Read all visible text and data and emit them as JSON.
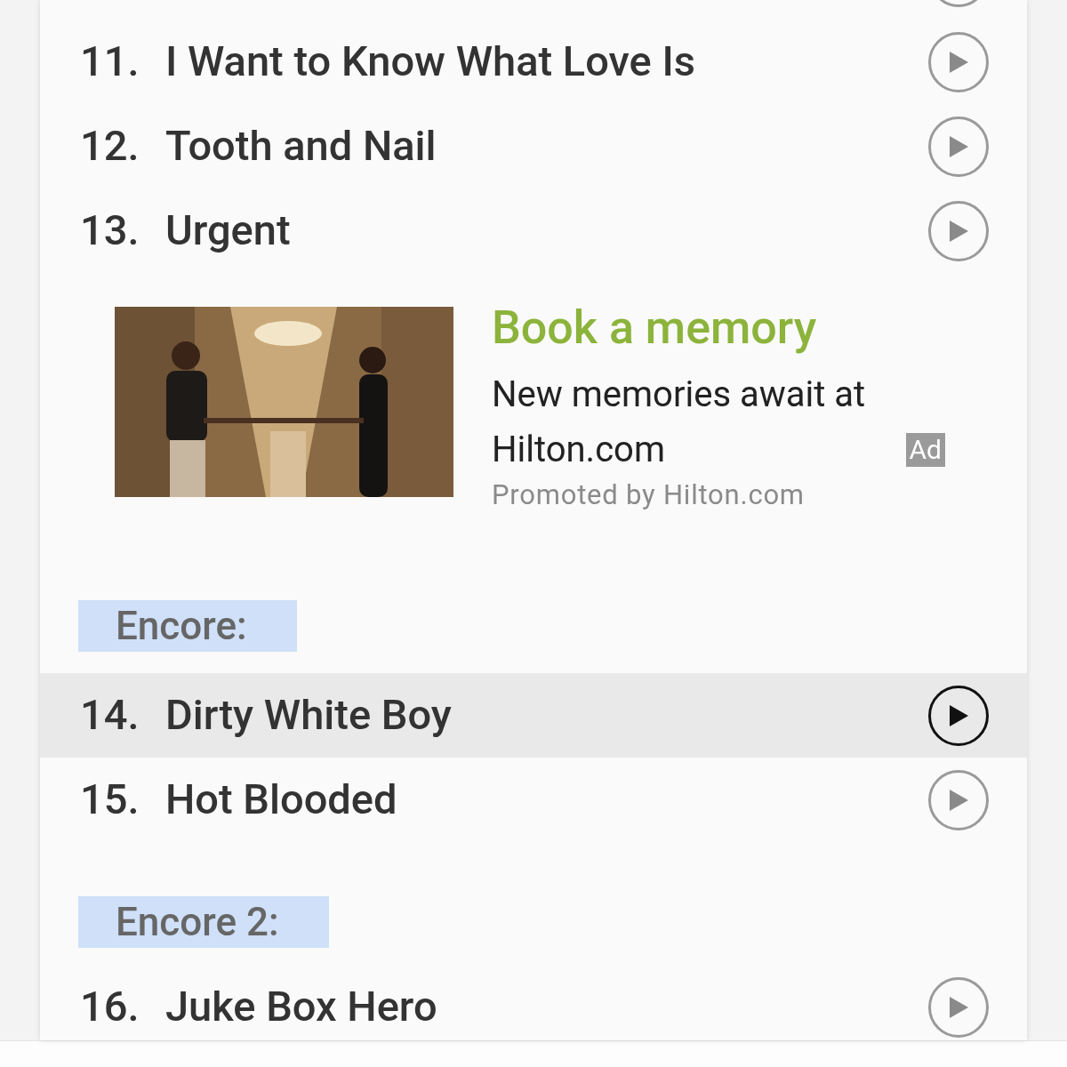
{
  "items": [
    {
      "kind": "track",
      "number": "11.",
      "title": "I Want to Know What Love Is",
      "selected": false
    },
    {
      "kind": "track",
      "number": "12.",
      "title": "Tooth and Nail",
      "selected": false
    },
    {
      "kind": "track",
      "number": "13.",
      "title": "Urgent",
      "selected": false
    },
    {
      "kind": "ad",
      "title": "Book a memory",
      "body": "New memories await at Hilton.com",
      "badge": "Ad",
      "sponsor": "Promoted by Hilton.com"
    },
    {
      "kind": "heading",
      "label": "Encore:"
    },
    {
      "kind": "track",
      "number": "14.",
      "title": "Dirty White Boy",
      "selected": true
    },
    {
      "kind": "track",
      "number": "15.",
      "title": "Hot Blooded",
      "selected": false
    },
    {
      "kind": "heading",
      "label": "Encore 2:"
    },
    {
      "kind": "track",
      "number": "16.",
      "title": "Juke Box Hero",
      "selected": false
    }
  ]
}
